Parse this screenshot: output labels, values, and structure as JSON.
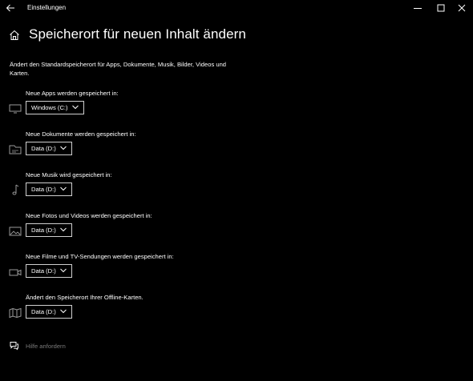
{
  "window": {
    "title": "Einstellungen",
    "controls": [
      "minimize-icon",
      "maximize-icon",
      "close-icon"
    ]
  },
  "page": {
    "title": "Speicherort für neuen Inhalt ändern",
    "description": "Ändert den Standardspeicherort für Apps, Dokumente, Musik, Bilder, Videos und Karten."
  },
  "settings": [
    {
      "label": "Neue Apps werden gespeichert in:",
      "value": "Windows (C:)",
      "icon": "monitor-icon"
    },
    {
      "label": "Neue Dokumente werden gespeichert in:",
      "value": "Data (D:)",
      "icon": "document-drive-icon"
    },
    {
      "label": "Neue Musik wird gespeichert in:",
      "value": "Data (D:)",
      "icon": "music-note-icon"
    },
    {
      "label": "Neue Fotos und Videos werden gespeichert in:",
      "value": "Data (D:)",
      "icon": "photo-icon"
    },
    {
      "label": "Neue Filme und TV-Sendungen werden gespeichert in:",
      "value": "Data (D:)",
      "icon": "video-camera-icon"
    },
    {
      "label": "Ändert den Speicherort Ihrer Offline-Karten.",
      "value": "Data (D:)",
      "icon": "map-icon"
    }
  ],
  "help": {
    "label": "Hilfe anfordern"
  },
  "colors": {
    "background": "#000000",
    "text": "#ffffff",
    "muted": "#7a7a7a",
    "dropdown_border": "#cfcfcf"
  }
}
